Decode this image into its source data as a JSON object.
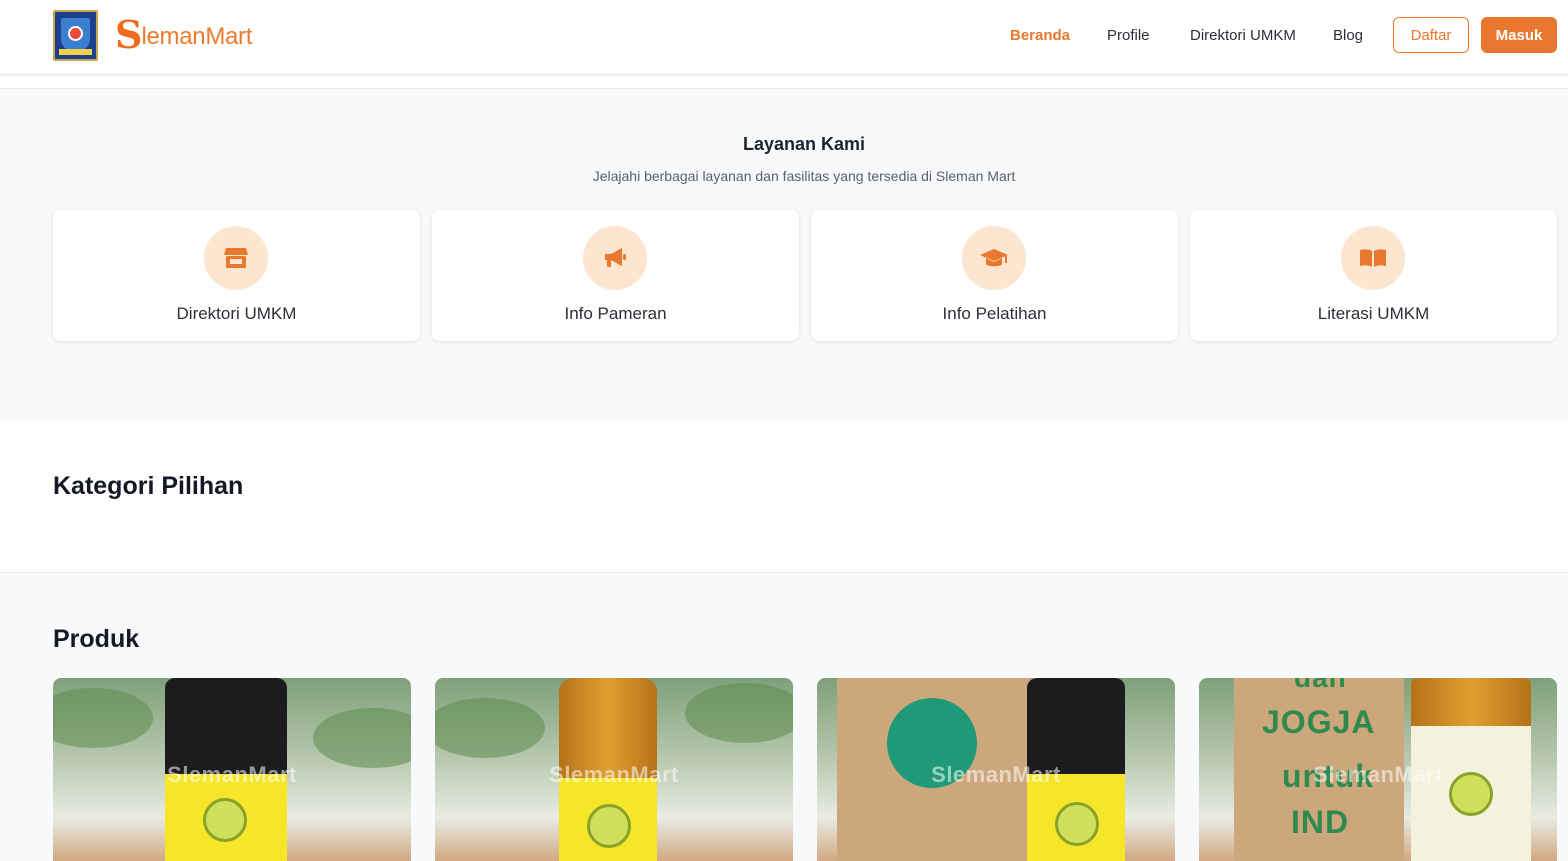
{
  "header": {
    "brand_s": "S",
    "brand_text": "lemanMart",
    "nav": [
      "Beranda",
      "Profile",
      "Direktori UMKM",
      "Blog"
    ],
    "daftar_label": "Daftar",
    "masuk_label": "Masuk"
  },
  "services": {
    "title": "Layanan Kami",
    "subtitle": "Jelajahi berbagai layanan dan fasilitas yang tersedia di Sleman Mart",
    "cards": [
      {
        "label": "Direktori UMKM",
        "icon": "store-icon"
      },
      {
        "label": "Info Pameran",
        "icon": "megaphone-icon"
      },
      {
        "label": "Info Pelatihan",
        "icon": "graduation-cap-icon"
      },
      {
        "label": "Literasi UMKM",
        "icon": "open-book-icon"
      }
    ]
  },
  "kategori": {
    "title": "Kategori Pilihan"
  },
  "produk": {
    "title": "Produk",
    "watermark": "SlemanMart",
    "items": [
      {
        "watermark": "SlemanMart"
      },
      {
        "watermark": "SlemanMart"
      },
      {
        "watermark": "SlemanMart"
      },
      {
        "watermark": "SlemanMart"
      }
    ],
    "box_text": [
      "dan",
      "JOGJA",
      "untuk",
      "IND"
    ]
  },
  "colors": {
    "accent": "#e8782e",
    "icon_circle": "#fde5cf",
    "section_bg": "#f8f9fb"
  }
}
